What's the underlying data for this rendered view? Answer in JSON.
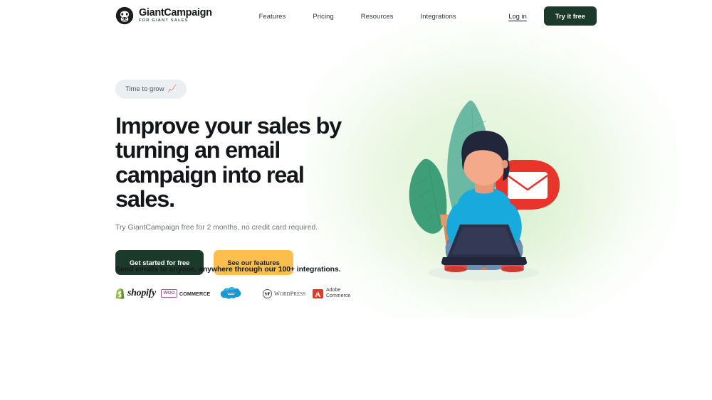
{
  "brand": {
    "name": "GiantCampaign",
    "tagline": "FOR GIANT SALES",
    "logo_icon": "gorilla-head-icon"
  },
  "nav": {
    "links": [
      {
        "label": "Features"
      },
      {
        "label": "Pricing"
      },
      {
        "label": "Resources"
      },
      {
        "label": "Integrations"
      }
    ],
    "login_label": "Log in",
    "cta_label": "Try it free"
  },
  "hero": {
    "pill_label": "Time to grow",
    "pill_emoji": "📈",
    "headline": "Improve your sales by turning an email campaign into real sales.",
    "subhead": "Try GiantCampaign free for 2 months, no credit card required.",
    "primary_cta": "Get started for free",
    "secondary_cta": "See our features",
    "illustration_alt": "person-sitting-with-laptop-illustration"
  },
  "integrations": {
    "title": "Send emails to anyone, anywhere through our 100+ integrations.",
    "logos": [
      {
        "name": "shopify",
        "label": "shopify"
      },
      {
        "name": "woocommerce",
        "badge": "WOO",
        "label": "COMMERCE"
      },
      {
        "name": "salesforce",
        "label": ""
      },
      {
        "name": "wordpress",
        "label": "WordPress"
      },
      {
        "name": "adobe-commerce",
        "line1": "Adobe",
        "line2": "Commerce"
      }
    ]
  },
  "colors": {
    "dark_green": "#1c3a2b",
    "amber": "#fcbf4e",
    "pill_grey": "#eceff1",
    "text_dark": "#141619",
    "text_muted": "#6b7178",
    "bubble_red": "#e8342a",
    "shirt_blue": "#18a9dd",
    "leaf_teal": "#5fb39a",
    "leaf_green": "#3d9e77",
    "pot_terracotta": "#d18a5d",
    "skin": "#f4a98a",
    "hair_navy": "#22263a",
    "jeans_blue": "#6286a8",
    "shoe_red": "#e84a3d"
  }
}
